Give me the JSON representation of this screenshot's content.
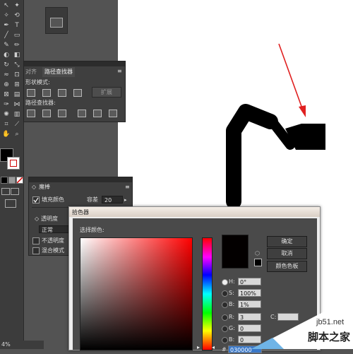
{
  "toolbar": {
    "type_tool_glyph": "T",
    "zoom_label": "4%"
  },
  "pathfinder_panel": {
    "tab_align": "对齐",
    "tab_pathfinder": "路径查找器",
    "shape_modes_label": "形状模式:",
    "expand_button": "扩展",
    "pathfinders_label": "路径查找器:"
  },
  "magic_wand_panel": {
    "title": "魔棒",
    "fill_color_label": "填充颜色",
    "tolerance_label": "容差",
    "tolerance_value": "20",
    "opacity_label": "透明度",
    "mode_value": "正常",
    "opacity_check_label": "不透明度",
    "blend_mode_label": "混合模式"
  },
  "color_picker": {
    "title": "拾色器",
    "select_color_label": "选择颜色:",
    "ok_button": "确定",
    "cancel_button": "取消",
    "swatches_button": "颜色色板",
    "hsb": {
      "h_label": "H:",
      "h_value": "0°",
      "s_label": "S:",
      "s_value": "100%",
      "b_label": "B:",
      "b_value": "1%"
    },
    "rgb": {
      "r_label": "R:",
      "r_value": "3",
      "g_label": "G:",
      "g_value": "0",
      "b_label": "B:",
      "b_value": "0"
    },
    "c_label": "C:",
    "hex_prefix": "#",
    "hex_value": "030000",
    "current_color": "#030000"
  },
  "watermark": {
    "site": "jb51.net",
    "name": "脚本之家"
  }
}
